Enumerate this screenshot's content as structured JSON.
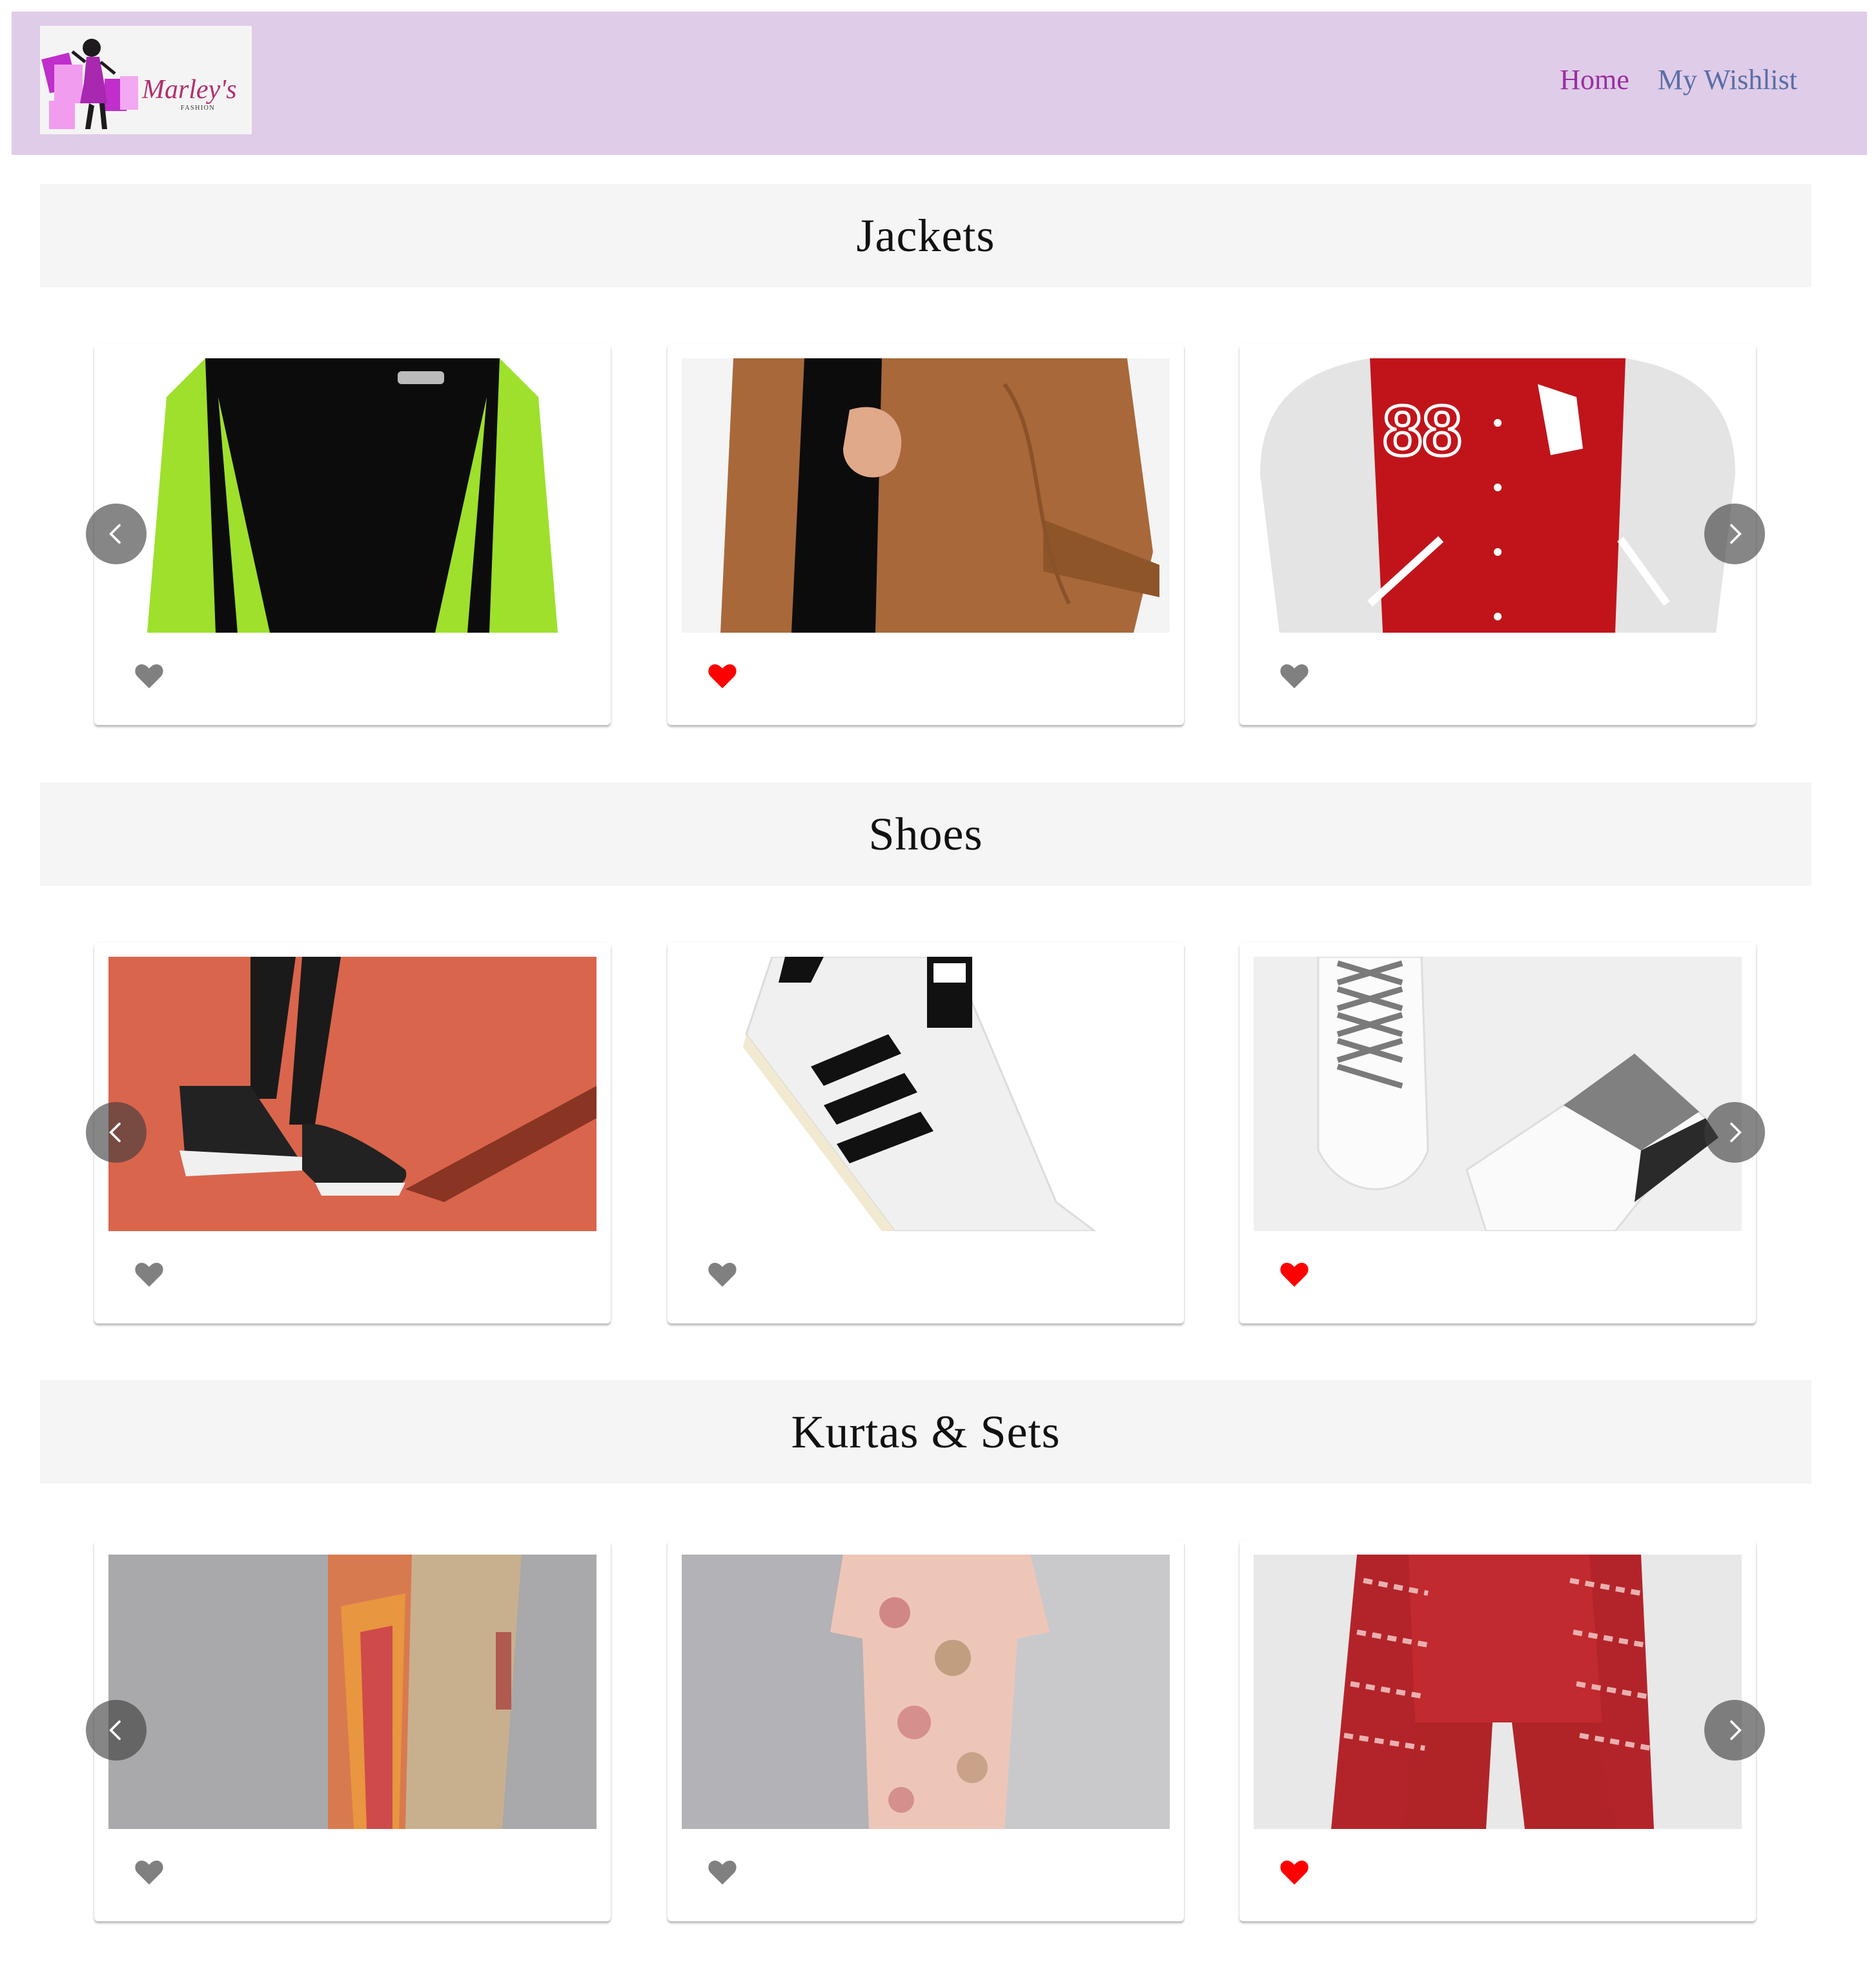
{
  "navbar": {
    "logo": {
      "brand": "Marley's",
      "tagline": "FASHION",
      "alt": "Marley's Fashion logo"
    },
    "links": [
      {
        "label": "Home",
        "color": "#9a2fa0"
      },
      {
        "label": "My Wishlist",
        "color": "#5a6ea6"
      }
    ],
    "background": "#dfcce8"
  },
  "sections": [
    {
      "title": "Jackets",
      "products": [
        {
          "image": "Green and black sports jacket",
          "wishlisted": false
        },
        {
          "image": "Brown leather jacket",
          "wishlisted": true
        },
        {
          "image": "Red and white varsity jacket",
          "wishlisted": false
        }
      ]
    },
    {
      "title": "Shoes",
      "products": [
        {
          "image": "Black running shoes on red track",
          "wishlisted": false
        },
        {
          "image": "White adidas Superstar sneaker",
          "wishlisted": false
        },
        {
          "image": "White and grey sneakers",
          "wishlisted": true
        }
      ]
    },
    {
      "title": "Kurtas & Sets",
      "products": [
        {
          "image": "Beige kurta with orange dupatta",
          "wishlisted": false
        },
        {
          "image": "Floral pink kurta set",
          "wishlisted": false
        },
        {
          "image": "Red kurta set with dupatta",
          "wishlisted": true
        }
      ]
    }
  ],
  "carousel": {
    "prev_label": "Previous",
    "next_label": "Next"
  },
  "colors": {
    "heart_active": "#ff0000",
    "heart_inactive": "#808080",
    "section_bg": "#f5f5f5"
  }
}
